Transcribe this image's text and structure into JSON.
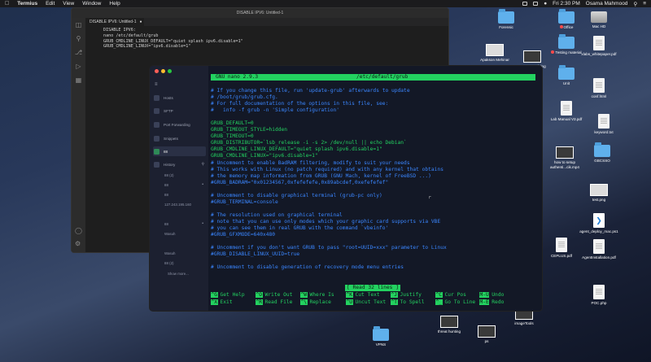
{
  "menubar": {
    "app": "Termius",
    "items": [
      "Edit",
      "View",
      "Window",
      "Help"
    ],
    "clock": "Fri 2:30 PM",
    "user": "Osama Mahmood"
  },
  "desktop_icons": [
    {
      "label": "Forensic",
      "icon": "folder-icon"
    },
    {
      "label": "Office",
      "icon": "folder-icon"
    },
    {
      "label": "Mac HD",
      "icon": "drive-icon"
    },
    {
      "label": "Testing material",
      "icon": "folder-icon"
    },
    {
      "label": "xlabs_whitepaper.pdf",
      "icon": "document-icon"
    },
    {
      "label": "Apakson Mehinar",
      "icon": "thumbnail-icon"
    },
    {
      "label": "...green.Training",
      "icon": "thumbnail-icon"
    },
    {
      "label": "Unit",
      "icon": "folder-icon"
    },
    {
      "label": "conf.html",
      "icon": "document-icon"
    },
    {
      "label": "Lab Manual V3.pdf",
      "icon": "document-icon"
    },
    {
      "label": "keyword.txt",
      "icon": "document-icon"
    },
    {
      "label": "how to setup authenti...cik.mp4",
      "icon": "video-icon"
    },
    {
      "label": "GBCSSO",
      "icon": "folder-icon"
    },
    {
      "label": "test.png",
      "icon": "image-icon"
    },
    {
      "label": "agent_deploy_mac.ps1",
      "icon": "vscode-document-icon"
    },
    {
      "label": "CEPLUS.pdf",
      "icon": "document-icon"
    },
    {
      "label": "AgentInstallation.pdf",
      "icon": "document-icon"
    },
    {
      "label": "POC.php",
      "icon": "document-icon"
    },
    {
      "label": "imageTools",
      "icon": "image-icon"
    },
    {
      "label": "threat hunting",
      "icon": "thumbnail-icon"
    },
    {
      "label": "ps",
      "icon": "thumbnail-icon"
    },
    {
      "label": "VPNS",
      "icon": "folder-icon"
    }
  ],
  "vscode": {
    "window_title": "DISABLE IPV6: Untitled-1",
    "tab_label": "DISABLE IPV6: Untitled-1",
    "lines": [
      "DISABLE IPV6:",
      "nano /etc/default/grub",
      "",
      "GRUB_CMDLINE_LINUX_DEFAULT=\"quiet splash ipv6.disable=1\"",
      "GRUB_CMDLINE_LINUX=\"ipv6.disable=1\""
    ]
  },
  "termius": {
    "sidebar": {
      "nav": [
        {
          "label": "Hosts",
          "name": "nav-hosts"
        },
        {
          "label": "SFTP",
          "name": "nav-sftp"
        },
        {
          "label": "Port Forwarding",
          "name": "nav-port-forwarding"
        },
        {
          "label": "Snippets",
          "name": "nav-snippets"
        },
        {
          "label": "88",
          "name": "nav-session"
        }
      ],
      "history_label": "History",
      "history": [
        "88 (2)",
        "88",
        "88",
        "127.243.195.160",
        "88",
        "Wasuh",
        "Wasuh",
        "88 (2)"
      ],
      "show_more": "Show more..."
    },
    "nano": {
      "title_left": "GNU nano 2.9.3",
      "title_file": "/etc/default/grub",
      "lines": [
        {
          "text": "# If you change this file, run 'update-grub' afterwards to update",
          "color": "blue"
        },
        {
          "text": "# /boot/grub/grub.cfg.",
          "color": "blue"
        },
        {
          "text": "# For full documentation of the options in this file, see:",
          "color": "blue"
        },
        {
          "text": "#   info -f grub -n 'Simple configuration'",
          "color": "blue"
        },
        {
          "text": "",
          "color": "blue"
        },
        {
          "text": "GRUB_DEFAULT=0",
          "color": "green"
        },
        {
          "text": "GRUB_TIMEOUT_STYLE=hidden",
          "color": "green"
        },
        {
          "text": "GRUB_TIMEOUT=0",
          "color": "green"
        },
        {
          "text": "GRUB_DISTRIBUTOR=`lsb_release -i -s 2> /dev/null || echo Debian`",
          "color": "green"
        },
        {
          "text": "GRUB_CMDLINE_LINUX_DEFAULT=\"quiet splash ipv6.disable=1\"",
          "color": "green"
        },
        {
          "text": "GRUB_CMDLINE_LINUX=\"ipv6.disable=1\"",
          "color": "green"
        },
        {
          "text": "# Uncomment to enable BadRAM filtering, modify to suit your needs",
          "color": "blue"
        },
        {
          "text": "# This works with Linux (no patch required) and with any kernel that obtains",
          "color": "blue"
        },
        {
          "text": "# the memory map information from GRUB (GNU Mach, kernel of FreeBSD ...)",
          "color": "blue"
        },
        {
          "text": "#GRUB_BADRAM=\"0x01234567,0xfefefefe,0x89abcdef,0xefefefef\"",
          "color": "blue"
        },
        {
          "text": "",
          "color": "blue"
        },
        {
          "text": "# Uncomment to disable graphical terminal (grub-pc only)",
          "color": "blue"
        },
        {
          "text": "#GRUB_TERMINAL=console",
          "color": "blue"
        },
        {
          "text": "",
          "color": "blue"
        },
        {
          "text": "# The resolution used on graphical terminal",
          "color": "blue"
        },
        {
          "text": "# note that you can use only modes which your graphic card supports via VBE",
          "color": "blue"
        },
        {
          "text": "# you can see them in real GRUB with the command `vbeinfo'",
          "color": "blue"
        },
        {
          "text": "#GRUB_GFXMODE=640x480",
          "color": "blue"
        },
        {
          "text": "",
          "color": "blue"
        },
        {
          "text": "# Uncomment if you don't want GRUB to pass \"root=UUID=xxx\" parameter to Linux",
          "color": "blue"
        },
        {
          "text": "#GRUB_DISABLE_LINUX_UUID=true",
          "color": "blue"
        },
        {
          "text": "",
          "color": "blue"
        },
        {
          "text": "# Uncomment to disable generation of recovery mode menu entries",
          "color": "blue"
        }
      ],
      "status": "[ Read 32 lines ]",
      "shortcuts_row1": [
        {
          "key": "^G",
          "label": "Get Help"
        },
        {
          "key": "^O",
          "label": "Write Out"
        },
        {
          "key": "^W",
          "label": "Where Is"
        },
        {
          "key": "^K",
          "label": "Cut Text"
        },
        {
          "key": "^J",
          "label": "Justify"
        },
        {
          "key": "^C",
          "label": "Cur Pos"
        },
        {
          "key": "M-U",
          "label": "Undo"
        }
      ],
      "shortcuts_row2": [
        {
          "key": "^X",
          "label": "Exit"
        },
        {
          "key": "^R",
          "label": "Read File"
        },
        {
          "key": "^\\",
          "label": "Replace"
        },
        {
          "key": "^U",
          "label": "Uncut Text"
        },
        {
          "key": "^T",
          "label": "To Spell"
        },
        {
          "key": "^_",
          "label": "Go To Line"
        },
        {
          "key": "M-E",
          "label": "Redo"
        }
      ]
    }
  },
  "colors": {
    "nano_green": "#23d160",
    "nano_blue": "#3a86ff",
    "terminal_bg": "#131826"
  }
}
